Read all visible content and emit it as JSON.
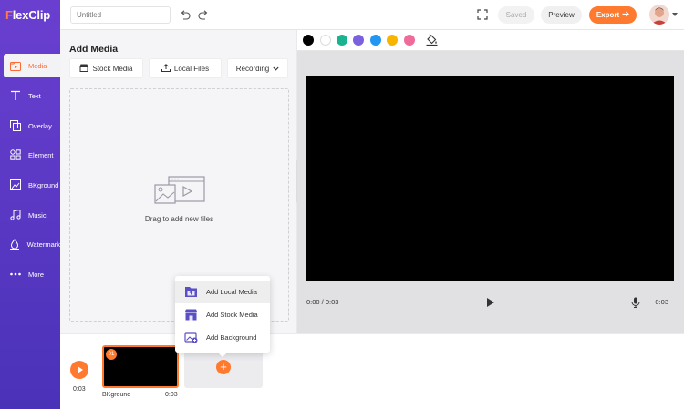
{
  "app": {
    "logo_prefix": "F",
    "logo_rest": "lexClip"
  },
  "sidebar": {
    "items": [
      {
        "label": "Media",
        "icon": "media-icon",
        "active": true
      },
      {
        "label": "Text",
        "icon": "text-icon",
        "active": false
      },
      {
        "label": "Overlay",
        "icon": "overlay-icon",
        "active": false
      },
      {
        "label": "Element",
        "icon": "element-icon",
        "active": false
      },
      {
        "label": "BKground",
        "icon": "background-icon",
        "active": false
      },
      {
        "label": "Music",
        "icon": "music-icon",
        "active": false
      },
      {
        "label": "Watermark",
        "icon": "watermark-icon",
        "active": false
      },
      {
        "label": "More",
        "icon": "more-icon",
        "active": false
      }
    ]
  },
  "header": {
    "title_placeholder": "Untitled",
    "saved_label": "Saved",
    "preview_label": "Preview",
    "export_label": "Export"
  },
  "media_panel": {
    "title": "Add Media",
    "stock_media_label": "Stock Media",
    "local_files_label": "Local Files",
    "recording_label": "Recording",
    "drop_text": "Drag to add new files"
  },
  "colors": {
    "swatches": [
      "#000000",
      "#ffffff",
      "#19b38f",
      "#7b61e0",
      "#2196f3",
      "#f7b500",
      "#f06a9a"
    ],
    "accent": "#ff7a2e",
    "sidebar": "#5a37c8"
  },
  "player": {
    "current_time": "0:00 / 0:03",
    "duration": "0:03"
  },
  "timeline": {
    "time": "0:03",
    "clip": {
      "number": "01",
      "name": "BKground",
      "duration": "0:03"
    },
    "add_symbol": "+"
  },
  "add_menu": {
    "items": [
      {
        "label": "Add Local Media",
        "icon": "local-media-icon"
      },
      {
        "label": "Add Stock Media",
        "icon": "stock-media-icon"
      },
      {
        "label": "Add Background",
        "icon": "add-background-icon"
      }
    ]
  }
}
